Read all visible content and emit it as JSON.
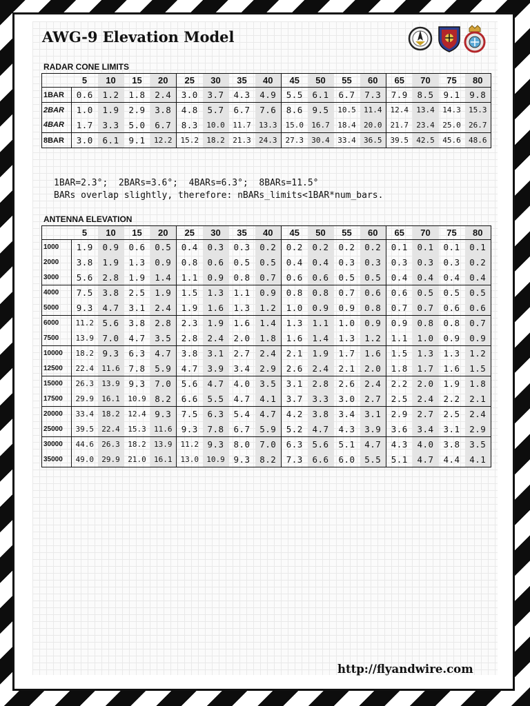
{
  "title": "AWG-9 Elevation Model",
  "logos": [
    "squadron-emblem-icon",
    "shield-crest-icon",
    "crowned-badge-icon"
  ],
  "radar_cone": {
    "title": "RADAR CONE LIMITS",
    "columns": [
      "5",
      "10",
      "15",
      "20",
      "25",
      "30",
      "35",
      "40",
      "45",
      "50",
      "55",
      "60",
      "65",
      "70",
      "75",
      "80"
    ],
    "rows": [
      {
        "label": "1BAR",
        "values": [
          "0.6",
          "1.2",
          "1.8",
          "2.4",
          "3.0",
          "3.7",
          "4.3",
          "4.9",
          "5.5",
          "6.1",
          "6.7",
          "7.3",
          "7.9",
          "8.5",
          "9.1",
          "9.8"
        ]
      },
      {
        "label": "2BAR",
        "values": [
          "1.0",
          "1.9",
          "2.9",
          "3.8",
          "4.8",
          "5.7",
          "6.7",
          "7.6",
          "8.6",
          "9.5",
          "10.5",
          "11.4",
          "12.4",
          "13.4",
          "14.3",
          "15.3"
        ]
      },
      {
        "label": "4BAR",
        "values": [
          "1.7",
          "3.3",
          "5.0",
          "6.7",
          "8.3",
          "10.0",
          "11.7",
          "13.3",
          "15.0",
          "16.7",
          "18.4",
          "20.0",
          "21.7",
          "23.4",
          "25.0",
          "26.7"
        ]
      },
      {
        "label": "8BAR",
        "values": [
          "3.0",
          "6.1",
          "9.1",
          "12.2",
          "15.2",
          "18.2",
          "21.3",
          "24.3",
          "27.3",
          "30.4",
          "33.4",
          "36.5",
          "39.5",
          "42.5",
          "45.6",
          "48.6"
        ]
      }
    ]
  },
  "note": {
    "line1": "1BAR=2.3°;  2BARs=3.6°;  4BARs=6.3°;  8BARs=11.5°",
    "line2": "BARs overlap slightly, therefore: nBARs_limits<1BAR*num_bars."
  },
  "antenna_elevation": {
    "title": "ANTENNA ELEVATION",
    "columns": [
      "5",
      "10",
      "15",
      "20",
      "25",
      "30",
      "35",
      "40",
      "45",
      "50",
      "55",
      "60",
      "65",
      "70",
      "75",
      "80"
    ],
    "rows": [
      {
        "label": "1000",
        "values": [
          "1.9",
          "0.9",
          "0.6",
          "0.5",
          "0.4",
          "0.3",
          "0.3",
          "0.2",
          "0.2",
          "0.2",
          "0.2",
          "0.2",
          "0.1",
          "0.1",
          "0.1",
          "0.1"
        ]
      },
      {
        "label": "2000",
        "values": [
          "3.8",
          "1.9",
          "1.3",
          "0.9",
          "0.8",
          "0.6",
          "0.5",
          "0.5",
          "0.4",
          "0.4",
          "0.3",
          "0.3",
          "0.3",
          "0.3",
          "0.3",
          "0.2"
        ]
      },
      {
        "label": "3000",
        "values": [
          "5.6",
          "2.8",
          "1.9",
          "1.4",
          "1.1",
          "0.9",
          "0.8",
          "0.7",
          "0.6",
          "0.6",
          "0.5",
          "0.5",
          "0.4",
          "0.4",
          "0.4",
          "0.4"
        ]
      },
      {
        "label": "4000",
        "values": [
          "7.5",
          "3.8",
          "2.5",
          "1.9",
          "1.5",
          "1.3",
          "1.1",
          "0.9",
          "0.8",
          "0.8",
          "0.7",
          "0.6",
          "0.6",
          "0.5",
          "0.5",
          "0.5"
        ]
      },
      {
        "label": "5000",
        "values": [
          "9.3",
          "4.7",
          "3.1",
          "2.4",
          "1.9",
          "1.6",
          "1.3",
          "1.2",
          "1.0",
          "0.9",
          "0.9",
          "0.8",
          "0.7",
          "0.7",
          "0.6",
          "0.6"
        ]
      },
      {
        "label": "6000",
        "values": [
          "11.2",
          "5.6",
          "3.8",
          "2.8",
          "2.3",
          "1.9",
          "1.6",
          "1.4",
          "1.3",
          "1.1",
          "1.0",
          "0.9",
          "0.9",
          "0.8",
          "0.8",
          "0.7"
        ]
      },
      {
        "label": "7500",
        "values": [
          "13.9",
          "7.0",
          "4.7",
          "3.5",
          "2.8",
          "2.4",
          "2.0",
          "1.8",
          "1.6",
          "1.4",
          "1.3",
          "1.2",
          "1.1",
          "1.0",
          "0.9",
          "0.9"
        ]
      },
      {
        "label": "10000",
        "values": [
          "18.2",
          "9.3",
          "6.3",
          "4.7",
          "3.8",
          "3.1",
          "2.7",
          "2.4",
          "2.1",
          "1.9",
          "1.7",
          "1.6",
          "1.5",
          "1.3",
          "1.3",
          "1.2"
        ]
      },
      {
        "label": "12500",
        "values": [
          "22.4",
          "11.6",
          "7.8",
          "5.9",
          "4.7",
          "3.9",
          "3.4",
          "2.9",
          "2.6",
          "2.4",
          "2.1",
          "2.0",
          "1.8",
          "1.7",
          "1.6",
          "1.5"
        ]
      },
      {
        "label": "15000",
        "values": [
          "26.3",
          "13.9",
          "9.3",
          "7.0",
          "5.6",
          "4.7",
          "4.0",
          "3.5",
          "3.1",
          "2.8",
          "2.6",
          "2.4",
          "2.2",
          "2.0",
          "1.9",
          "1.8"
        ]
      },
      {
        "label": "17500",
        "values": [
          "29.9",
          "16.1",
          "10.9",
          "8.2",
          "6.6",
          "5.5",
          "4.7",
          "4.1",
          "3.7",
          "3.3",
          "3.0",
          "2.7",
          "2.5",
          "2.4",
          "2.2",
          "2.1"
        ]
      },
      {
        "label": "20000",
        "values": [
          "33.4",
          "18.2",
          "12.4",
          "9.3",
          "7.5",
          "6.3",
          "5.4",
          "4.7",
          "4.2",
          "3.8",
          "3.4",
          "3.1",
          "2.9",
          "2.7",
          "2.5",
          "2.4"
        ]
      },
      {
        "label": "25000",
        "values": [
          "39.5",
          "22.4",
          "15.3",
          "11.6",
          "9.3",
          "7.8",
          "6.7",
          "5.9",
          "5.2",
          "4.7",
          "4.3",
          "3.9",
          "3.6",
          "3.4",
          "3.1",
          "2.9"
        ]
      },
      {
        "label": "30000",
        "values": [
          "44.6",
          "26.3",
          "18.2",
          "13.9",
          "11.2",
          "9.3",
          "8.0",
          "7.0",
          "6.3",
          "5.6",
          "5.1",
          "4.7",
          "4.3",
          "4.0",
          "3.8",
          "3.5"
        ]
      },
      {
        "label": "35000",
        "values": [
          "49.0",
          "29.9",
          "21.0",
          "16.1",
          "13.0",
          "10.9",
          "9.3",
          "8.2",
          "7.3",
          "6.6",
          "6.0",
          "5.5",
          "5.1",
          "4.7",
          "4.4",
          "4.1"
        ]
      }
    ]
  },
  "footer_url": "http://flyandwire.com"
}
